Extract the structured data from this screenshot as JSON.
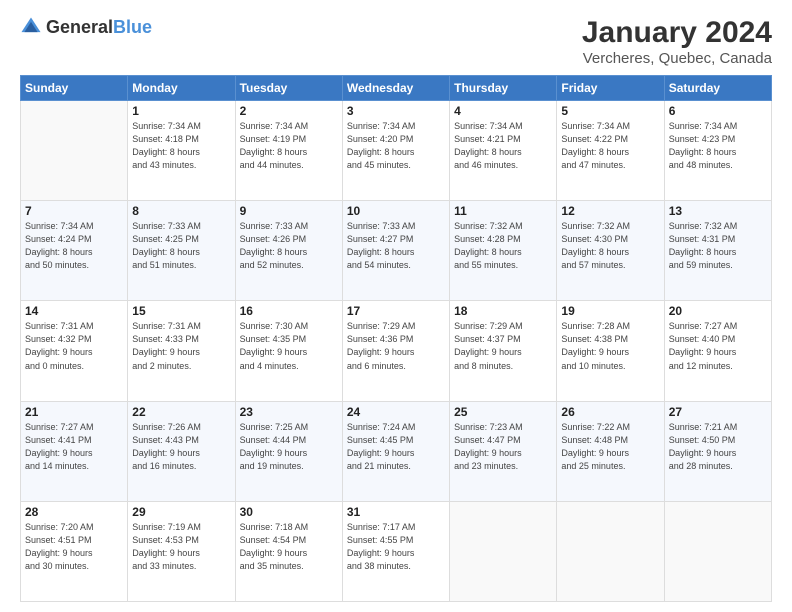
{
  "logo": {
    "text_general": "General",
    "text_blue": "Blue"
  },
  "header": {
    "title": "January 2024",
    "subtitle": "Vercheres, Quebec, Canada"
  },
  "days_of_week": [
    "Sunday",
    "Monday",
    "Tuesday",
    "Wednesday",
    "Thursday",
    "Friday",
    "Saturday"
  ],
  "weeks": [
    [
      {
        "day": "",
        "info": ""
      },
      {
        "day": "1",
        "info": "Sunrise: 7:34 AM\nSunset: 4:18 PM\nDaylight: 8 hours\nand 43 minutes."
      },
      {
        "day": "2",
        "info": "Sunrise: 7:34 AM\nSunset: 4:19 PM\nDaylight: 8 hours\nand 44 minutes."
      },
      {
        "day": "3",
        "info": "Sunrise: 7:34 AM\nSunset: 4:20 PM\nDaylight: 8 hours\nand 45 minutes."
      },
      {
        "day": "4",
        "info": "Sunrise: 7:34 AM\nSunset: 4:21 PM\nDaylight: 8 hours\nand 46 minutes."
      },
      {
        "day": "5",
        "info": "Sunrise: 7:34 AM\nSunset: 4:22 PM\nDaylight: 8 hours\nand 47 minutes."
      },
      {
        "day": "6",
        "info": "Sunrise: 7:34 AM\nSunset: 4:23 PM\nDaylight: 8 hours\nand 48 minutes."
      }
    ],
    [
      {
        "day": "7",
        "info": "Sunrise: 7:34 AM\nSunset: 4:24 PM\nDaylight: 8 hours\nand 50 minutes."
      },
      {
        "day": "8",
        "info": "Sunrise: 7:33 AM\nSunset: 4:25 PM\nDaylight: 8 hours\nand 51 minutes."
      },
      {
        "day": "9",
        "info": "Sunrise: 7:33 AM\nSunset: 4:26 PM\nDaylight: 8 hours\nand 52 minutes."
      },
      {
        "day": "10",
        "info": "Sunrise: 7:33 AM\nSunset: 4:27 PM\nDaylight: 8 hours\nand 54 minutes."
      },
      {
        "day": "11",
        "info": "Sunrise: 7:32 AM\nSunset: 4:28 PM\nDaylight: 8 hours\nand 55 minutes."
      },
      {
        "day": "12",
        "info": "Sunrise: 7:32 AM\nSunset: 4:30 PM\nDaylight: 8 hours\nand 57 minutes."
      },
      {
        "day": "13",
        "info": "Sunrise: 7:32 AM\nSunset: 4:31 PM\nDaylight: 8 hours\nand 59 minutes."
      }
    ],
    [
      {
        "day": "14",
        "info": "Sunrise: 7:31 AM\nSunset: 4:32 PM\nDaylight: 9 hours\nand 0 minutes."
      },
      {
        "day": "15",
        "info": "Sunrise: 7:31 AM\nSunset: 4:33 PM\nDaylight: 9 hours\nand 2 minutes."
      },
      {
        "day": "16",
        "info": "Sunrise: 7:30 AM\nSunset: 4:35 PM\nDaylight: 9 hours\nand 4 minutes."
      },
      {
        "day": "17",
        "info": "Sunrise: 7:29 AM\nSunset: 4:36 PM\nDaylight: 9 hours\nand 6 minutes."
      },
      {
        "day": "18",
        "info": "Sunrise: 7:29 AM\nSunset: 4:37 PM\nDaylight: 9 hours\nand 8 minutes."
      },
      {
        "day": "19",
        "info": "Sunrise: 7:28 AM\nSunset: 4:38 PM\nDaylight: 9 hours\nand 10 minutes."
      },
      {
        "day": "20",
        "info": "Sunrise: 7:27 AM\nSunset: 4:40 PM\nDaylight: 9 hours\nand 12 minutes."
      }
    ],
    [
      {
        "day": "21",
        "info": "Sunrise: 7:27 AM\nSunset: 4:41 PM\nDaylight: 9 hours\nand 14 minutes."
      },
      {
        "day": "22",
        "info": "Sunrise: 7:26 AM\nSunset: 4:43 PM\nDaylight: 9 hours\nand 16 minutes."
      },
      {
        "day": "23",
        "info": "Sunrise: 7:25 AM\nSunset: 4:44 PM\nDaylight: 9 hours\nand 19 minutes."
      },
      {
        "day": "24",
        "info": "Sunrise: 7:24 AM\nSunset: 4:45 PM\nDaylight: 9 hours\nand 21 minutes."
      },
      {
        "day": "25",
        "info": "Sunrise: 7:23 AM\nSunset: 4:47 PM\nDaylight: 9 hours\nand 23 minutes."
      },
      {
        "day": "26",
        "info": "Sunrise: 7:22 AM\nSunset: 4:48 PM\nDaylight: 9 hours\nand 25 minutes."
      },
      {
        "day": "27",
        "info": "Sunrise: 7:21 AM\nSunset: 4:50 PM\nDaylight: 9 hours\nand 28 minutes."
      }
    ],
    [
      {
        "day": "28",
        "info": "Sunrise: 7:20 AM\nSunset: 4:51 PM\nDaylight: 9 hours\nand 30 minutes."
      },
      {
        "day": "29",
        "info": "Sunrise: 7:19 AM\nSunset: 4:53 PM\nDaylight: 9 hours\nand 33 minutes."
      },
      {
        "day": "30",
        "info": "Sunrise: 7:18 AM\nSunset: 4:54 PM\nDaylight: 9 hours\nand 35 minutes."
      },
      {
        "day": "31",
        "info": "Sunrise: 7:17 AM\nSunset: 4:55 PM\nDaylight: 9 hours\nand 38 minutes."
      },
      {
        "day": "",
        "info": ""
      },
      {
        "day": "",
        "info": ""
      },
      {
        "day": "",
        "info": ""
      }
    ]
  ]
}
